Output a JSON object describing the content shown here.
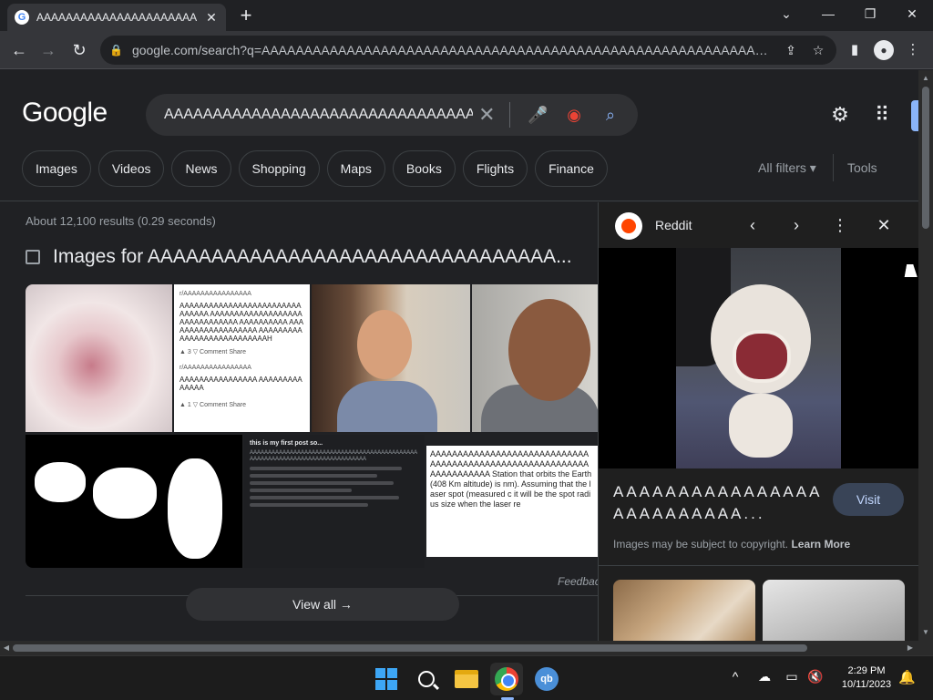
{
  "browser": {
    "tab_title": "AAAAAAAAAAAAAAAAAAAAAAA/",
    "url": "google.com/search?q=AAAAAAAAAAAAAAAAAAAAAAAAAAAAAAAAAAAAAAAAAAAAAAAAAAAAAAAAAAAAAAAAAAAAAAAAAAAAAA...",
    "favicon": "G"
  },
  "google": {
    "logo": "Google",
    "query": "AAAAAAAAAAAAAAAAAAAAAAAAAAAAAAAAAAAAAAAAA",
    "chips": [
      "Images",
      "Videos",
      "News",
      "Shopping",
      "Maps",
      "Books",
      "Flights",
      "Finance"
    ],
    "all_filters": "All filters ▾",
    "tools": "Tools",
    "results_count": "About 12,100 results (0.29 seconds)",
    "images_heading": "Images for AAAAAAAAAAAAAAAAAAAAAAAAAAAAAAAA...",
    "feedback": "Feedback",
    "view_all": "View all →"
  },
  "thumbs": {
    "reddit_sub": "r/AAAAAAAAAAAAAAAA",
    "reddit_text": "AAAAAAAAAAAAAAAAAAAAAAAAAAAAAAA AAAAAAAAAAAAAAAAAAAAAAAAAAAAAAA AAAAAAAAAA AAAAAAAAAAAAAAAAAAA AAAAAAAAAAAAAAAAAAAAAAAAAAAH",
    "reddit_meta": "▲ 3 ▽   Comment   Share",
    "reddit_sub2": "r/AAAAAAAAAAAAAAAA",
    "reddit_text2": "AAAAAAAAAAAAAAAA AAAAAAAAAAAAAA",
    "reddit_meta2": "▲ 1 ▽   Comment   Share",
    "post_title": "this is my first post so...",
    "post_body": "AAAAAAAAAAAAAAAAAAAAAAAAAAAAAAAAAAAAAAAAAAAAAAAAAAAAAAAAAAAAAAAAAAAAAAAAAAAAAA",
    "article_text": "AAAAAAAAAAAAAAAAAAAAAAAAAAAAAAAAAAAAAAAAAAAAAAAAAAAAAAAAAAAAAAAAAAAAA Station that orbits the Earth (408 Km altitude) is nm). Assuming that the laser spot (measured c it will be the spot radius size when the laser re"
  },
  "panel": {
    "source": "Reddit",
    "title": "AAAAAAAAAAAAAAAAAAAAAAAAAA...",
    "visit": "Visit",
    "copyright": "Images may be subject to copyright.",
    "learn_more": "Learn More"
  },
  "taskbar": {
    "time": "2:29 PM",
    "date": "10/11/2023",
    "qb_label": "qb"
  },
  "icons": {
    "close": "✕",
    "plus": "+",
    "back": "←",
    "forward": "→",
    "reload": "↻",
    "lock": "🔒",
    "share": "⇪",
    "star": "☆",
    "sidepanel": "▮",
    "profile": "●",
    "menu": "⋮",
    "clear": "✕",
    "mic": "🎤",
    "lens": "◉",
    "search": "⌕",
    "gear": "⚙",
    "apps": "⠿",
    "chev_left": "‹",
    "chev_right": "›",
    "caret_up": "^",
    "tray_cloud": "☁",
    "tray_net": "▭",
    "tray_vol": "🔇",
    "bell": "🔔",
    "minimize": "—",
    "restore": "❐",
    "collapse": "⌄"
  },
  "colors": {
    "page_bg": "#202124",
    "accent_blue": "#8ab4f8",
    "reddit_orange": "#ff4500"
  }
}
